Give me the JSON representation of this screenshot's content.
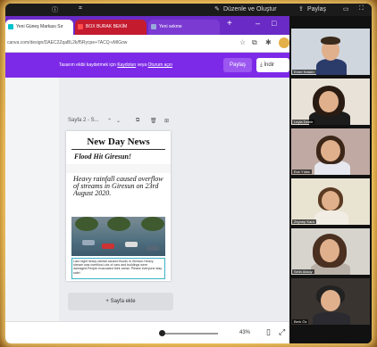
{
  "zoom_bar": {
    "share_label": "Paylaş",
    "record_label": "Düzenle ve Oluştur"
  },
  "browser": {
    "tabs": [
      {
        "label": "Yeni Güneş Markası Sır",
        "active": true
      },
      {
        "label": "BOX BURAK BEKİM",
        "active": false
      },
      {
        "label": "Yeni sekme",
        "active": false
      }
    ],
    "new_tab": "+",
    "url": "canva.com/design/DAEC2ZqaBL2k/f5Rycpe+7ACQ-vMlGow"
  },
  "promo": {
    "text_pre": "Tasarım ekibi kaydetmek için",
    "link1": "Kaydolun",
    "text_mid": "veya",
    "link2": "Oturum açın",
    "share_button": "Paylaş",
    "download_button": "İndir"
  },
  "editor": {
    "page_label": "Sayfa 2 - S...",
    "add_page_button": "+ Sayfa ekle",
    "zoom_value": "43%"
  },
  "newspaper": {
    "title": "New Day News",
    "subtitle": "Flood Hit Giresun!",
    "headline": "Heavy rainfall caused overflow of streams in Giresun on 23rd August 2020.",
    "body": "Last night heavy rainfall caused floods in Giresun.Heavy stream was overflow.Lots of cars and buildings were damaged.People evacuated their areas. Please everyone stay safe!"
  },
  "participants": [
    {
      "name": "Emre Keskin"
    },
    {
      "name": "Leyla Demir"
    },
    {
      "name": "Ece Yıldız"
    },
    {
      "name": "Zeynep Kara"
    },
    {
      "name": "Selin Aksoy"
    },
    {
      "name": "Berk Öz"
    }
  ]
}
